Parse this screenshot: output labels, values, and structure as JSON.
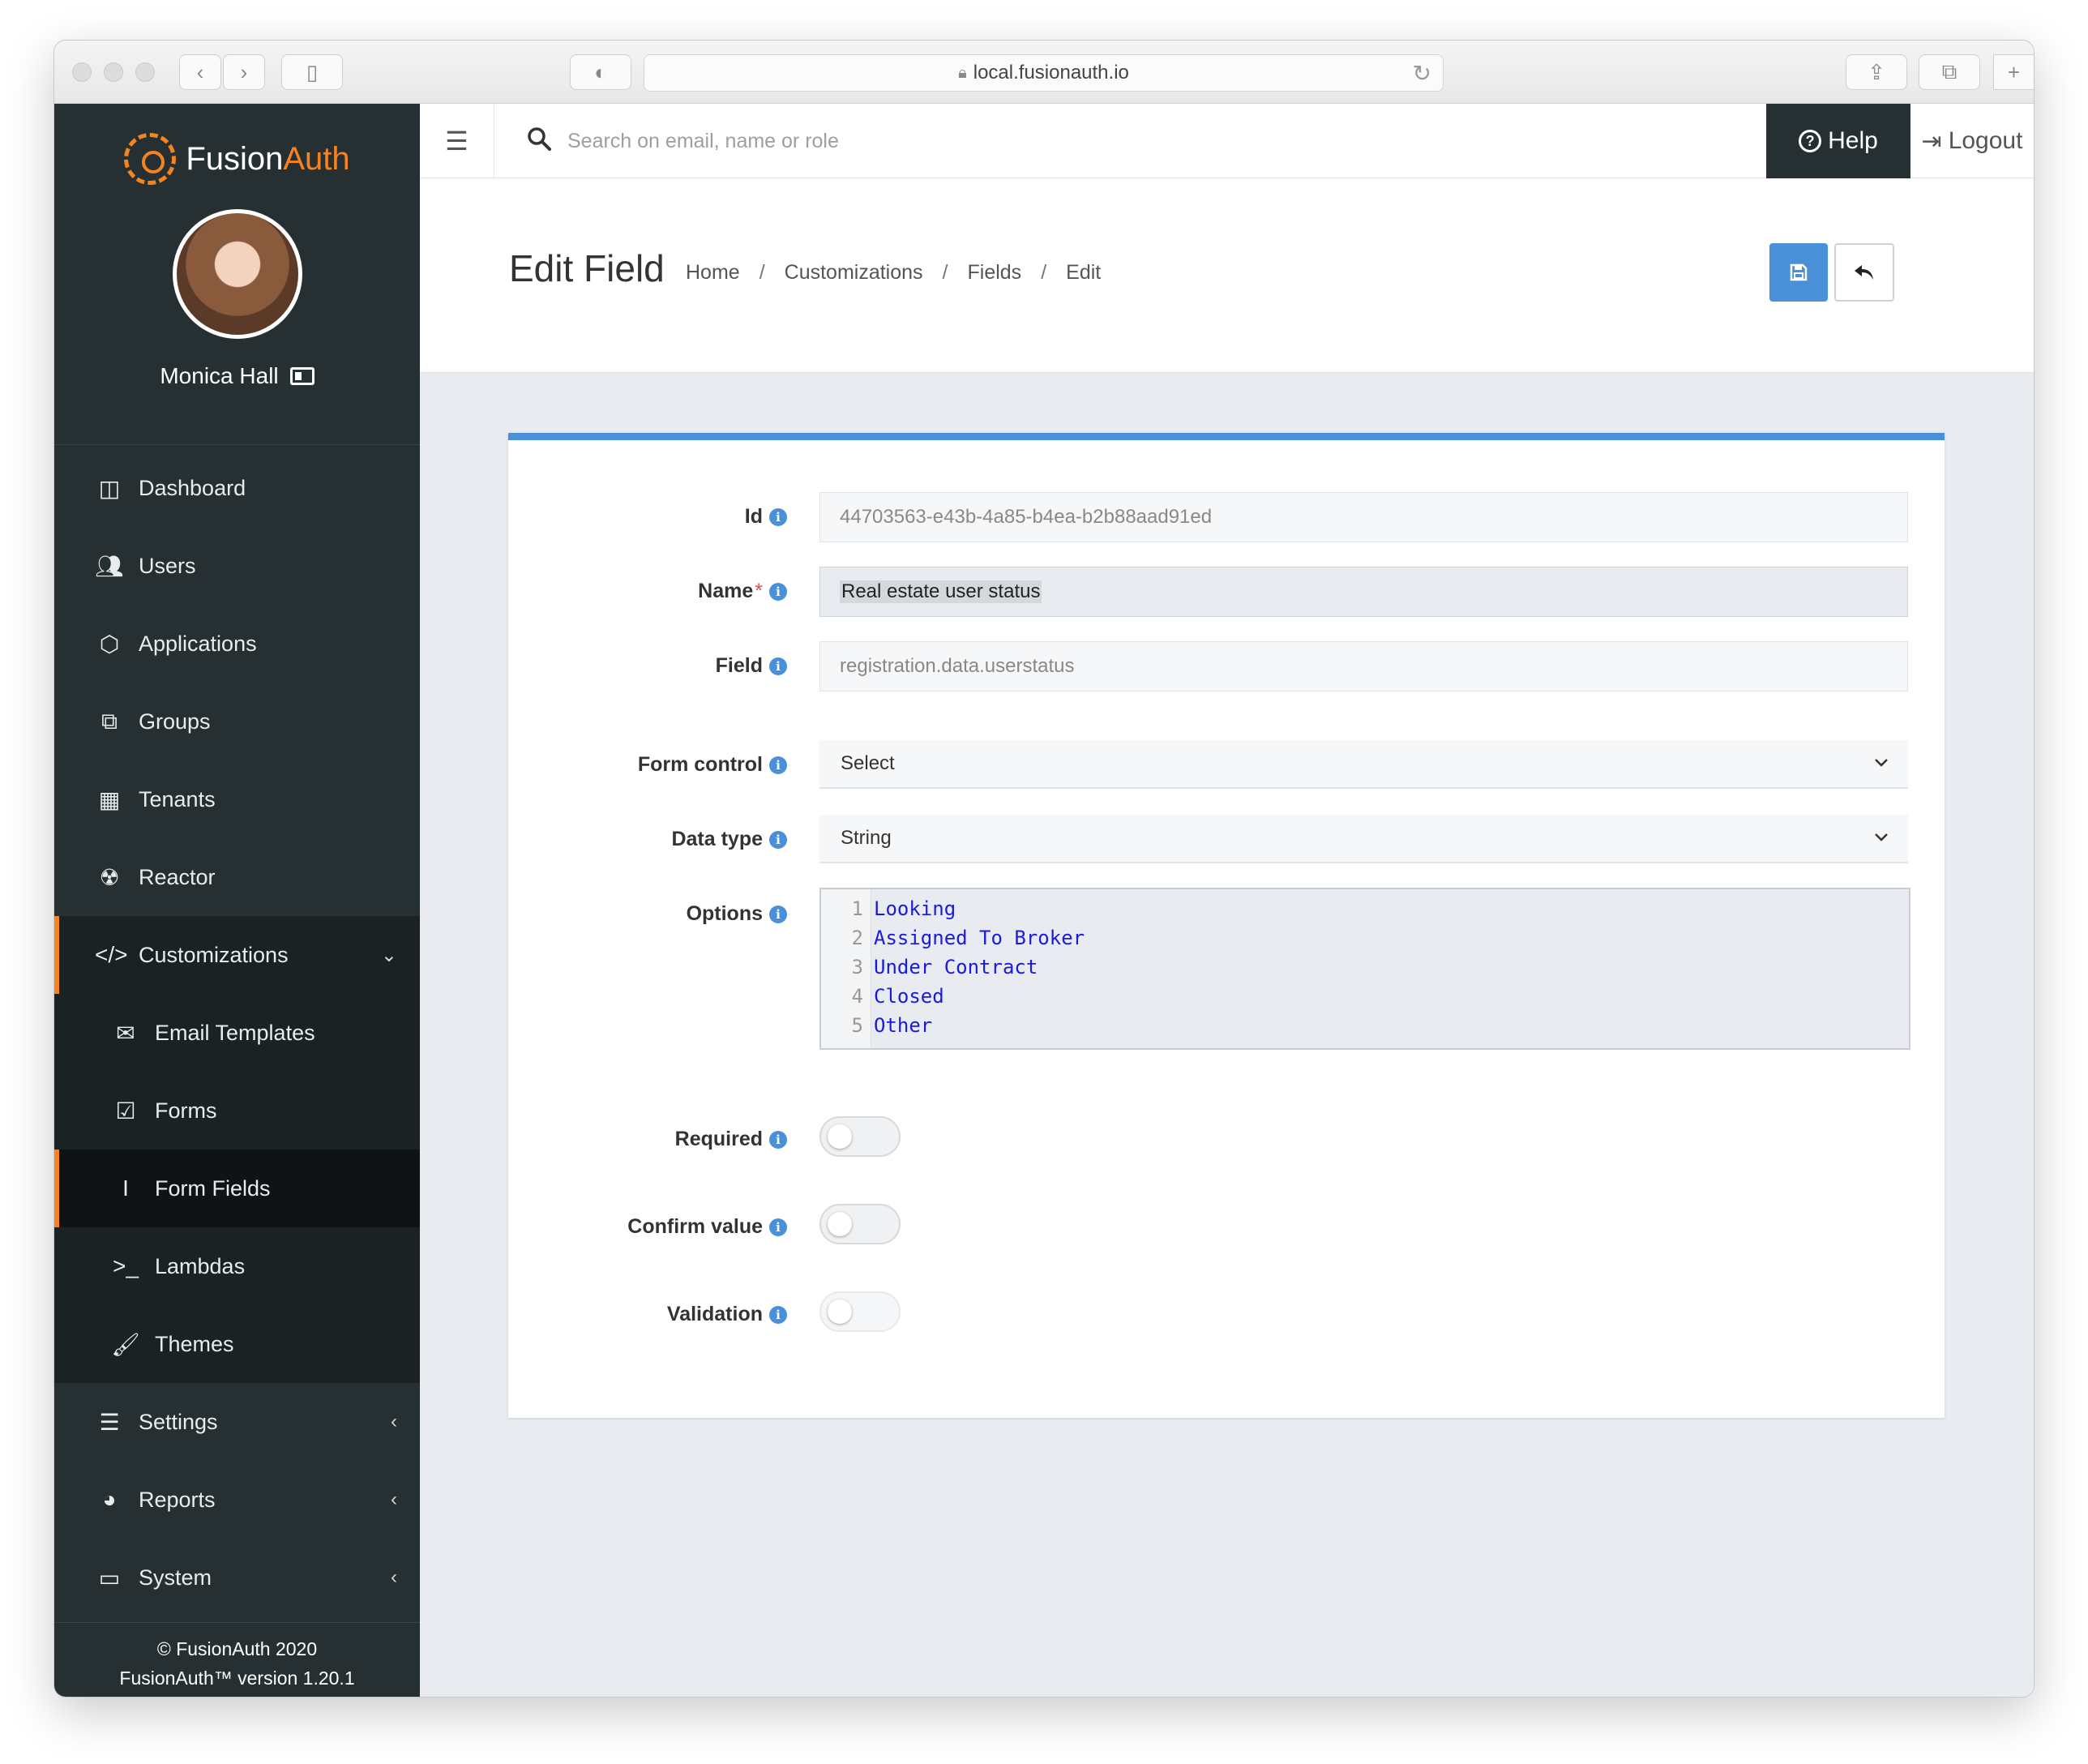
{
  "browser": {
    "url": "local.fusionauth.io"
  },
  "sidebar": {
    "brand_main": "Fusion",
    "brand_accent": "Auth",
    "user_name": "Monica Hall",
    "items": [
      {
        "label": "Dashboard",
        "icon": "columns-icon"
      },
      {
        "label": "Users",
        "icon": "users-icon"
      },
      {
        "label": "Applications",
        "icon": "cube-icon"
      },
      {
        "label": "Groups",
        "icon": "groups-icon"
      },
      {
        "label": "Tenants",
        "icon": "building-icon"
      },
      {
        "label": "Reactor",
        "icon": "reactor-icon"
      },
      {
        "label": "Customizations",
        "icon": "code-icon"
      },
      {
        "label": "Email Templates",
        "icon": "envelope-icon"
      },
      {
        "label": "Forms",
        "icon": "check-square-icon"
      },
      {
        "label": "Form Fields",
        "icon": "i-cursor-icon"
      },
      {
        "label": "Lambdas",
        "icon": "terminal-icon"
      },
      {
        "label": "Themes",
        "icon": "paint-brush-icon"
      },
      {
        "label": "Settings",
        "icon": "sliders-icon"
      },
      {
        "label": "Reports",
        "icon": "pie-chart-icon"
      },
      {
        "label": "System",
        "icon": "desktop-icon"
      }
    ],
    "footer_line1": "© FusionAuth 2020",
    "footer_line2": "FusionAuth™ version 1.20.1"
  },
  "topbar": {
    "search_placeholder": "Search on email, name or role",
    "help_label": "Help",
    "logout_label": "Logout"
  },
  "page": {
    "title": "Edit Field",
    "breadcrumb": [
      "Home",
      "Customizations",
      "Fields",
      "Edit"
    ]
  },
  "form": {
    "id_label": "Id",
    "id_value": "44703563-e43b-4a85-b4ea-b2b88aad91ed",
    "name_label": "Name",
    "name_required_mark": "*",
    "name_value": "Real estate user status",
    "field_label": "Field",
    "field_value": "registration.data.userstatus",
    "form_control_label": "Form control",
    "form_control_value": "Select",
    "data_type_label": "Data type",
    "data_type_value": "String",
    "options_label": "Options",
    "options": [
      {
        "n": "1",
        "text": "Looking"
      },
      {
        "n": "2",
        "text": "Assigned To Broker"
      },
      {
        "n": "3",
        "text": "Under Contract"
      },
      {
        "n": "4",
        "text": "Closed"
      },
      {
        "n": "5",
        "text": "Other"
      }
    ],
    "required_label": "Required",
    "required_on": false,
    "confirm_label": "Confirm value",
    "confirm_on": false,
    "validation_label": "Validation",
    "validation_on": false
  },
  "colors": {
    "accent_orange": "#f58320",
    "primary_blue": "#4a90d9",
    "sidebar_bg": "#263033"
  }
}
